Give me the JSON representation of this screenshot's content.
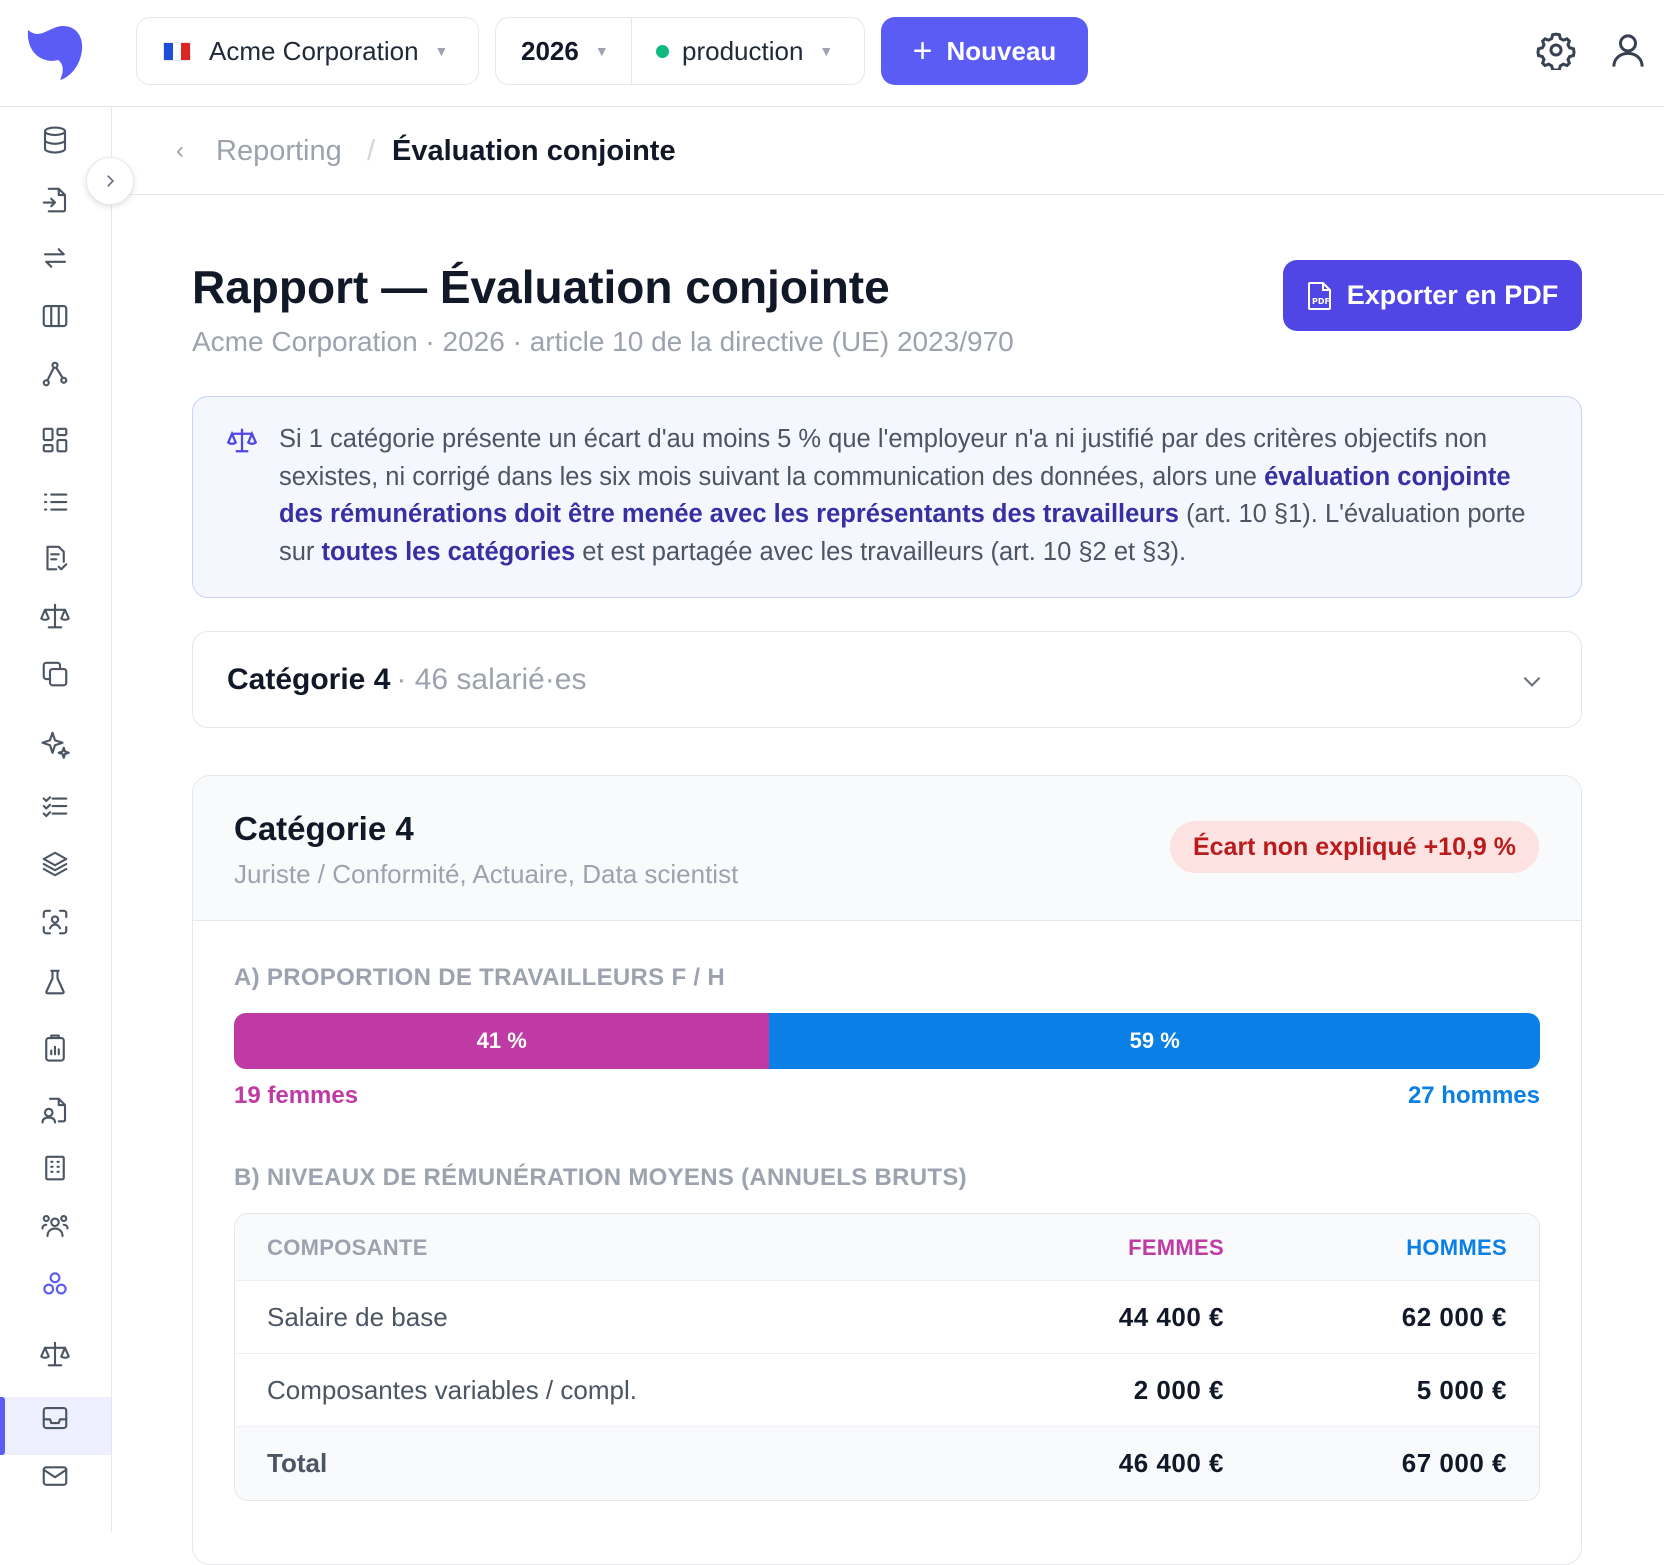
{
  "topbar": {
    "company": "Acme Corporation",
    "year": "2026",
    "environment": "production",
    "new_button": "Nouveau"
  },
  "breadcrumb": {
    "parent": "Reporting",
    "current": "Évaluation conjointe"
  },
  "header": {
    "title": "Rapport — Évaluation conjointe",
    "subtitle": "Acme Corporation · 2026 · article 10 de la directive (UE) 2023/970",
    "export_button": "Exporter en PDF"
  },
  "info": {
    "p1": "Si 1 catégorie présente un écart d'au moins 5 % que l'employeur n'a ni justifié par des critères objectifs non sexistes, ni corrigé dans les six mois suivant la communication des données, alors une ",
    "b1": "évaluation conjointe des rémunérations doit être menée avec les représentants des travailleurs",
    "p2": " (art. 10 §1). L'évaluation porte sur ",
    "b2": "toutes les catégories",
    "p3": " et est partagée avec les travailleurs (art. 10 §2 et §3)."
  },
  "selector": {
    "name": "Catégorie 4",
    "count": "· 46 salarié·es"
  },
  "category": {
    "title": "Catégorie 4",
    "jobs": "Juriste / Conformité, Actuaire, Data scientist",
    "badge": "Écart non expliqué +10,9 %",
    "section_a": "A) PROPORTION DE TRAVAILLEURS F / H",
    "women_pct": 41,
    "men_pct": 59,
    "women_pct_label": "41 %",
    "men_pct_label": "59 %",
    "women_count": "19 femmes",
    "men_count": "27 hommes",
    "section_b": "B) NIVEAUX DE RÉMUNÉRATION MOYENS (ANNUELS BRUTS)",
    "table": {
      "headers": [
        "COMPOSANTE",
        "FEMMES",
        "HOMMES"
      ],
      "rows": [
        [
          "Salaire de base",
          "44 400 €",
          "62 000 €"
        ],
        [
          "Composantes variables / compl.",
          "2 000 €",
          "5 000 €"
        ],
        [
          "Total",
          "46 400 €",
          "67 000 €"
        ]
      ]
    }
  },
  "colors": {
    "accent": "#5b5bf6",
    "women": "#c03aa6",
    "men": "#0a7fe6",
    "badge_bg": "#fde2e2",
    "badge_text": "#b91c1c"
  },
  "sidebar_icons": [
    "database-icon",
    "file-import-icon",
    "transfer-icon",
    "columns-icon",
    "network-icon",
    "dashboard-icon",
    "list-icon",
    "document-check-icon",
    "scale-icon",
    "copy-icon",
    "sparkles-icon",
    "checklist-icon",
    "layers-icon",
    "scan-face-icon",
    "flask-icon",
    "clipboard-chart-icon",
    "file-user-icon",
    "building-icon",
    "team-icon",
    "groups-icon",
    "balance-icon",
    "inbox-icon",
    "mail-icon"
  ]
}
